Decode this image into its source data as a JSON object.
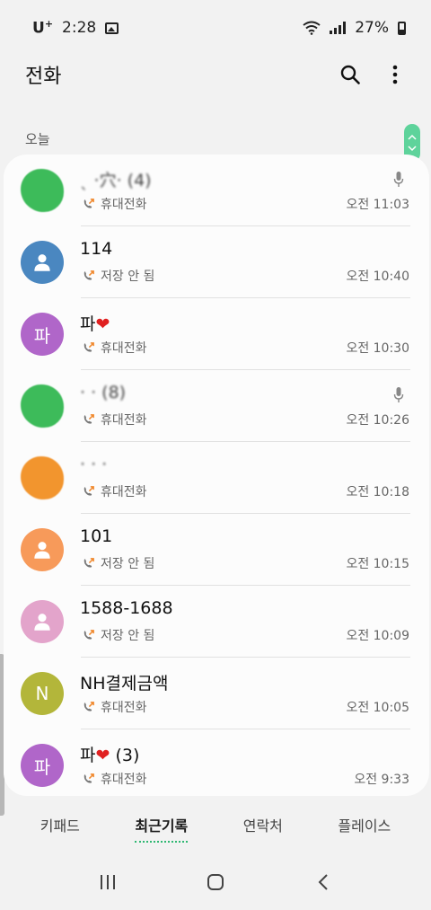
{
  "status_bar": {
    "carrier": "U",
    "carrier_sup": "+",
    "time": "2:28",
    "battery": "27%"
  },
  "app_bar": {
    "title": "전화",
    "search_icon": "search-icon",
    "more_icon": "more-vert-icon"
  },
  "section": {
    "label": "오늘"
  },
  "calls": [
    {
      "name": "ˎ ·穴· (4)",
      "type": "휴대전화",
      "time": "오전 11:03",
      "avatar_letter": "",
      "avatar_color": "#3dbb5a",
      "avatar_kind": "blurred",
      "mic": true
    },
    {
      "name": "114",
      "type": "저장 안 됨",
      "time": "오전 10:40",
      "avatar_letter": "",
      "avatar_color": "#4a87c0",
      "avatar_kind": "person",
      "mic": false
    },
    {
      "name": "파",
      "heart": "❤",
      "type": "휴대전화",
      "time": "오전 10:30",
      "avatar_letter": "파",
      "avatar_color": "#b066c9",
      "avatar_kind": "letter",
      "mic": false
    },
    {
      "name": "· · (8)",
      "type": "휴대전화",
      "time": "오전 10:26",
      "avatar_letter": "",
      "avatar_color": "#3dbb5a",
      "avatar_kind": "blurred",
      "mic": true
    },
    {
      "name": "· · ·",
      "type": "휴대전화",
      "time": "오전 10:18",
      "avatar_letter": "",
      "avatar_color": "#f2952e",
      "avatar_kind": "blurred",
      "mic": false
    },
    {
      "name": "101",
      "type": "저장 안 됨",
      "time": "오전 10:15",
      "avatar_letter": "",
      "avatar_color": "#f79a5a",
      "avatar_kind": "person",
      "mic": false
    },
    {
      "name": "1588-1688",
      "type": "저장 안 됨",
      "time": "오전 10:09",
      "avatar_letter": "",
      "avatar_color": "#e3a4cb",
      "avatar_kind": "person",
      "mic": false
    },
    {
      "name": "NH결제금액",
      "type": "휴대전화",
      "time": "오전 10:05",
      "avatar_letter": "N",
      "avatar_color": "#b3b63a",
      "avatar_kind": "letter",
      "mic": false
    },
    {
      "name": "파",
      "heart": "❤",
      "suffix": " (3)",
      "type": "휴대전화",
      "time": "오전 9:33",
      "avatar_letter": "파",
      "avatar_color": "#b066c9",
      "avatar_kind": "letter",
      "mic": false
    }
  ],
  "tabs": [
    {
      "label": "키패드",
      "active": false
    },
    {
      "label": "최근기록",
      "active": true
    },
    {
      "label": "연락처",
      "active": false
    },
    {
      "label": "플레이스",
      "active": false
    }
  ],
  "colors": {
    "accent": "#2eb872",
    "scroll_pill": "#5ed39b",
    "missed_arrow": "#f0872b"
  }
}
